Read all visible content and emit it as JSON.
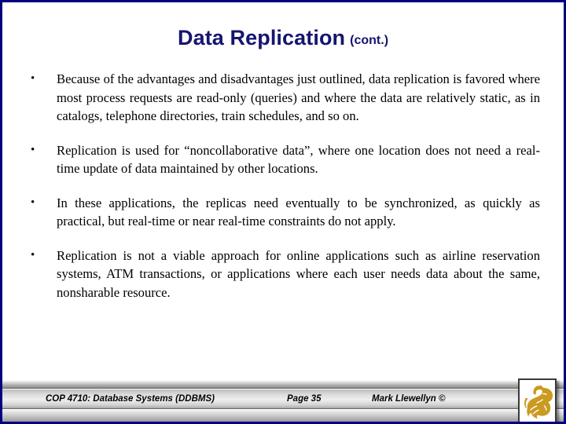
{
  "slide": {
    "border_color": "#000080",
    "background_color": "#ffffff"
  },
  "title": {
    "main": "Data Replication",
    "suffix": "(cont.)",
    "color": "#151570"
  },
  "body": {
    "bullet_marker": "•",
    "bullets": [
      {
        "text": "Because of the advantages and disadvantages just outlined, data replication is favored where most process requests are read-only (queries) and where the data are relatively static, as in catalogs, telephone directories, train schedules, and so on."
      },
      {
        "text": "Replication is used for “noncollaborative data”, where one location does not need a real-time update of data maintained by other locations."
      },
      {
        "text": "In these applications, the replicas need eventually to be synchronized, as quickly as practical, but real-time or near real-time constraints do not apply."
      },
      {
        "text": "Replication is not a viable approach for online applications such as airline reservation systems, ATM transactions, or applications where each user needs data about the same, nonsharable resource."
      }
    ]
  },
  "footer": {
    "course": "COP 4710: Database Systems  (DDBMS)",
    "page": "Page 35",
    "author": "Mark Llewellyn ©",
    "logo": {
      "name": "ucf-pegasus-logo",
      "color": "#CB9A20"
    }
  }
}
